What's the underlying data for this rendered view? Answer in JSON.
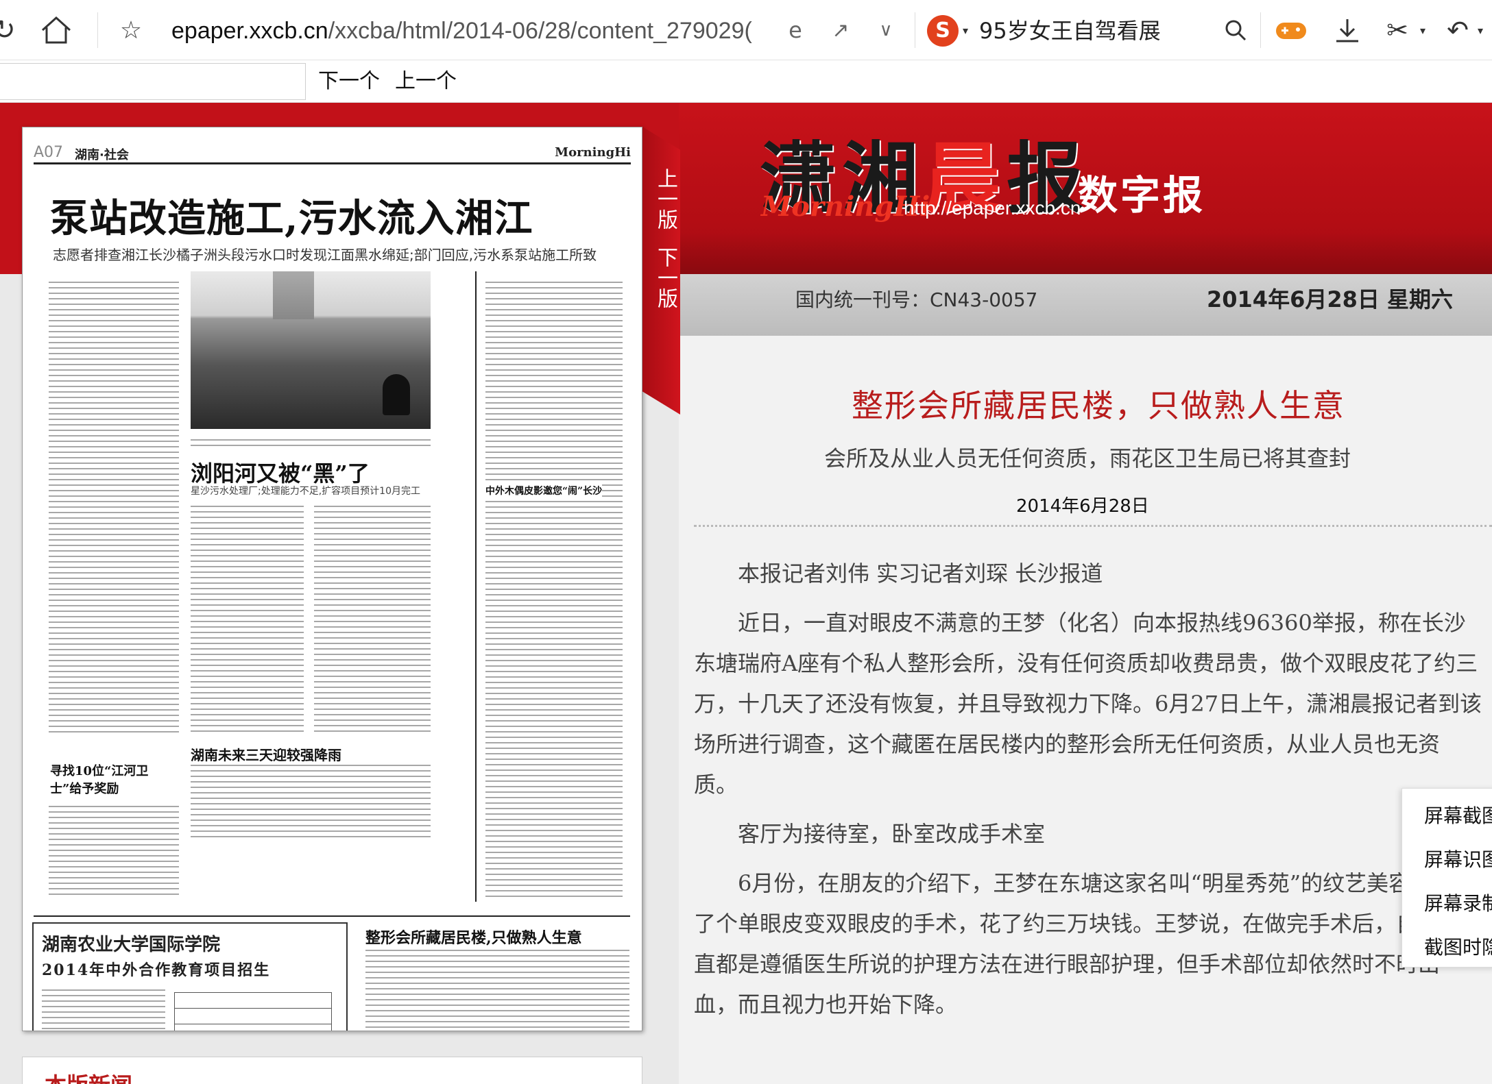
{
  "browser": {
    "url_host": "epaper.xxcb.cn",
    "url_path": "/xxcba/html/2014-06/28/content_279029(",
    "search_text": "95岁女王自驾看展",
    "icons": [
      "refresh-icon",
      "home-icon",
      "star-icon",
      "ie-engine-icon",
      "share-icon",
      "chevron-down-icon",
      "sogou-search-icon",
      "search-icon",
      "game-controller-icon",
      "download-icon",
      "scissors-icon",
      "undo-icon"
    ]
  },
  "findbar": {
    "next_label": "下一个",
    "prev_label": "上一个"
  },
  "masthead": {
    "title_cn_a": "潇湘",
    "title_cn_b": "晨",
    "title_cn_c": "报",
    "title_en": "MorningHi",
    "url": "http://epaper.xxcb.cn",
    "digital": "数字报",
    "issn": "国内统一刊号：CN43-0057",
    "date": "2014年6月28日  星期六"
  },
  "flip": {
    "prev": "上一版",
    "next": "下一版"
  },
  "newspaper": {
    "page_no": "A07",
    "section": "湖南·社会",
    "brand": "MorningHi",
    "headline": "泵站改造施工,污水流入湘江",
    "subhead": "志愿者排查湘江长沙橘子洲头段污水口时发现江面黑水绵延;部门回应,污水系泵站施工所致",
    "story2": "浏阳河又被“黑”了",
    "story2_sub": "星沙污水处理厂;处理能力不足,扩容项目预计10月完工",
    "story3": "湖南未来三天迎较强降雨",
    "story4": "寻找10位“江河卫士”给予奖励",
    "story5": "整形会所藏居民楼,只做熟人生意",
    "story6": "中外木偶皮影邀您“闹”长沙",
    "ad_title": "湖南农业大学国际学院",
    "ad_sub": "2014年中外合作教育项目招生"
  },
  "article": {
    "title": "整形会所藏居民楼，只做熟人生意",
    "subtitle": "会所及从业人员无任何资质，雨花区卫生局已将其查封",
    "date": "2014年6月28日",
    "paragraphs": [
      "本报记者刘伟 实习记者刘琛 长沙报道",
      "近日，一直对眼皮不满意的王梦（化名）向本报热线96360举报，称在长沙东塘瑞府A座有个私人整形会所，没有任何资质却收费昂贵，做个双眼皮花了约三万，十几天了还没有恢复，并且导致视力下降。6月27日上午，潇湘晨报记者到该场所进行调查，这个藏匿在居民楼内的整形会所无任何资质，从业人员也无资质。",
      "客厅为接待室，卧室改成手术室",
      "6月份，在朋友的介绍下，王梦在东塘这家名叫“明星秀苑”的纹艺美容会所做了个单眼皮变双眼皮的手术，花了约三万块钱。王梦说，在做完手术后，自己一直都是遵循医生所说的护理方法在进行眼部护理，但手术部位却依然时不时出血，而且视力也开始下降。"
    ]
  },
  "context_menu": {
    "items": [
      "屏幕截图",
      "屏幕识图",
      "屏幕录制",
      "截图时隐"
    ]
  },
  "news_box": {
    "title": "本版新闻"
  }
}
